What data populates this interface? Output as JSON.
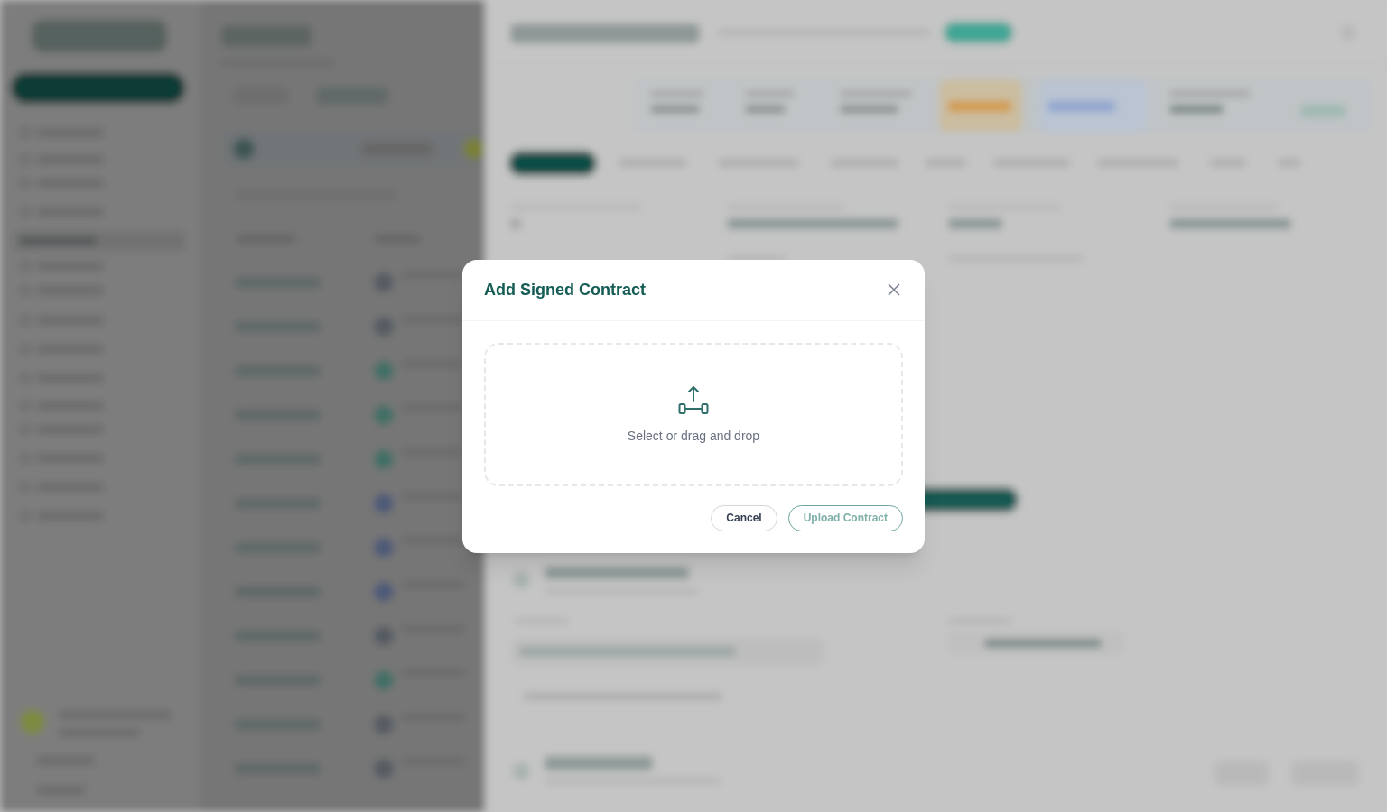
{
  "modal": {
    "title": "Add Signed Contract",
    "dropzone": {
      "prompt": "Select or drag and drop"
    },
    "buttons": [
      {
        "label": "Cancel",
        "kind": "secondary",
        "disabled": false
      },
      {
        "label": "Upload Contract",
        "kind": "primary",
        "disabled": true
      }
    ]
  }
}
